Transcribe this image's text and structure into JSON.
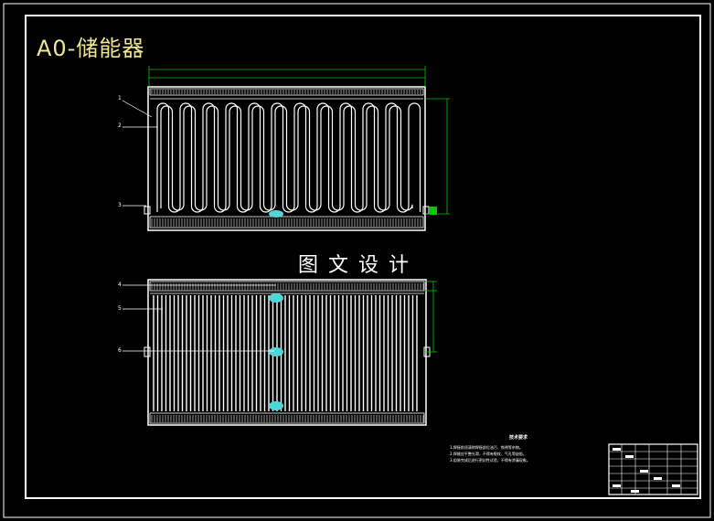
{
  "drawing": {
    "title": "A0-储能器",
    "watermark": "图文设计",
    "callouts": [
      "1",
      "2",
      "3",
      "4",
      "5",
      "6"
    ],
    "notes": {
      "title": "技术要求",
      "lines": [
        "1.焊接前须清除焊接部位油污、铁锈等杂物。",
        "2.焊缝应平整光滑，不得有裂纹、气孔等缺陷。",
        "3.组装完成后进行密封性试验，不得有渗漏现象。"
      ]
    }
  },
  "colors": {
    "background": "#000000",
    "linework": "#ffffff",
    "title": "#f2e68c",
    "dimension": "#00c800",
    "clip": "#4fd6d6"
  }
}
